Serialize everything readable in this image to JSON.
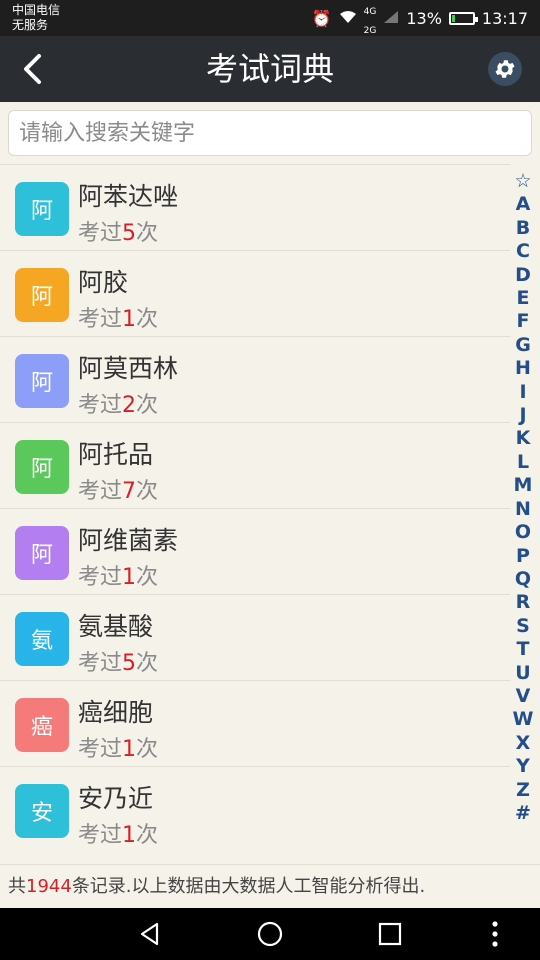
{
  "status": {
    "carrier_line1": "中国电信",
    "carrier_line2": "无服务",
    "network_label_top": "4G",
    "network_label_bottom": "2G",
    "battery_percent": "13%",
    "battery_level": 0.13,
    "time": "13:17"
  },
  "header": {
    "title": "考试词典"
  },
  "search": {
    "placeholder": "请输入搜索关键字",
    "value": ""
  },
  "list": {
    "count_prefix": "考过",
    "count_suffix": "次",
    "items": [
      {
        "badge": "阿",
        "name": "阿苯达唑",
        "times": "5",
        "color": "#2ec0d8"
      },
      {
        "badge": "阿",
        "name": "阿胶",
        "times": "1",
        "color": "#f5a623"
      },
      {
        "badge": "阿",
        "name": "阿莫西林",
        "times": "2",
        "color": "#8c9ef8"
      },
      {
        "badge": "阿",
        "name": "阿托品",
        "times": "7",
        "color": "#5ac85a"
      },
      {
        "badge": "阿",
        "name": "阿维菌素",
        "times": "1",
        "color": "#b37ff0"
      },
      {
        "badge": "氨",
        "name": "氨基酸",
        "times": "5",
        "color": "#28b4e8"
      },
      {
        "badge": "癌",
        "name": "癌细胞",
        "times": "1",
        "color": "#f57a7a"
      },
      {
        "badge": "安",
        "name": "安乃近",
        "times": "1",
        "color": "#2ec0d8"
      }
    ]
  },
  "index_letters": [
    "☆",
    "A",
    "B",
    "C",
    "D",
    "E",
    "F",
    "G",
    "H",
    "I",
    "J",
    "K",
    "L",
    "M",
    "N",
    "O",
    "P",
    "Q",
    "R",
    "S",
    "T",
    "U",
    "V",
    "W",
    "X",
    "Y",
    "Z",
    "#"
  ],
  "footer": {
    "prefix": "共",
    "total": "1944",
    "suffix": "条记录.以上数据由大数据人工智能分析得出."
  }
}
